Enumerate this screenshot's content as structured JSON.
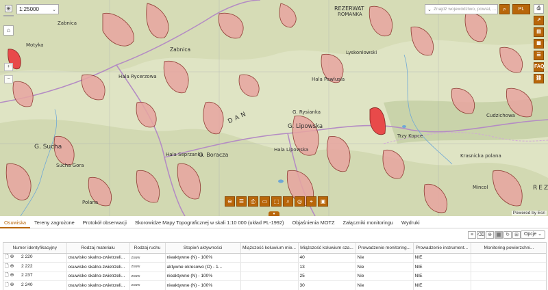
{
  "theme": {
    "accent": "#b8660a",
    "landslide_fill": "#e8a5a0",
    "landslide_outline": "#8b2e2a",
    "active_slide": "#e84a4a"
  },
  "header": {
    "language": "PL",
    "faq": "FAQ"
  },
  "search": {
    "placeholder": "Znajdź województwo, powiat, ..."
  },
  "map": {
    "scale": "1:25000",
    "attribution": "Powered by Esri",
    "labels": [
      "REZERWAT",
      "ROMANKA",
      "Lyskoniowski",
      "Hala Pawlusia",
      "G. Rysianka",
      "G. Lipowska",
      "Hala Lipowska",
      "G. Boracza",
      "Hala Seprzanka",
      "G. Sucha",
      "Zabnica",
      "Hala Rycerzowa",
      "Cudzichowa",
      "Krasnicka polana",
      "Mincol",
      "Trzy Kopce",
      "DAN",
      "Zabnica",
      "Motyka",
      "Sucha Gora",
      "Polana",
      "REZ"
    ]
  },
  "tabs": [
    "Osuwiska",
    "Tereny zagrożone",
    "Protokół obserwacji",
    "Skorowidze Mapy Topograficznej w skali 1:10 000 (układ PL-1992)",
    "Objaśnienia MOTZ",
    "Załączniki monitoringu",
    "Wydruki"
  ],
  "table": {
    "options_label": "Opcje",
    "columns": [
      "Numer identyfikacyjny",
      "Rodzaj materiału",
      "Rodzaj ruchu",
      "Stopień aktywności",
      "Miąższość koluwium mie...",
      "Miąższość koluwium sza...",
      "Prowadzenie monitoring...",
      "Prowadzenie instrument...",
      "Monitoring powierzchni..."
    ],
    "rows": [
      [
        "2 220",
        "osuwisko skalno-zwietrzeli...",
        "zsuw",
        "nieaktywne (N) - 100%",
        "",
        "40",
        "Nie",
        "NIE",
        ""
      ],
      [
        "2 222",
        "osuwisko skalno-zwietrzeli...",
        "zsuw",
        "aktywne okresowo (O) - 1...",
        "",
        "13",
        "Nie",
        "NIE",
        ""
      ],
      [
        "2 237",
        "osuwisko skalno-zwietrzeli...",
        "zsuw",
        "nieaktywne (N) - 100%",
        "",
        "25",
        "Nie",
        "NIE",
        ""
      ],
      [
        "2 240",
        "osuwisko skalno-zwietrzeli...",
        "zsuw",
        "nieaktywne (N) - 100%",
        "",
        "30",
        "Nie",
        "NIE",
        ""
      ]
    ]
  }
}
